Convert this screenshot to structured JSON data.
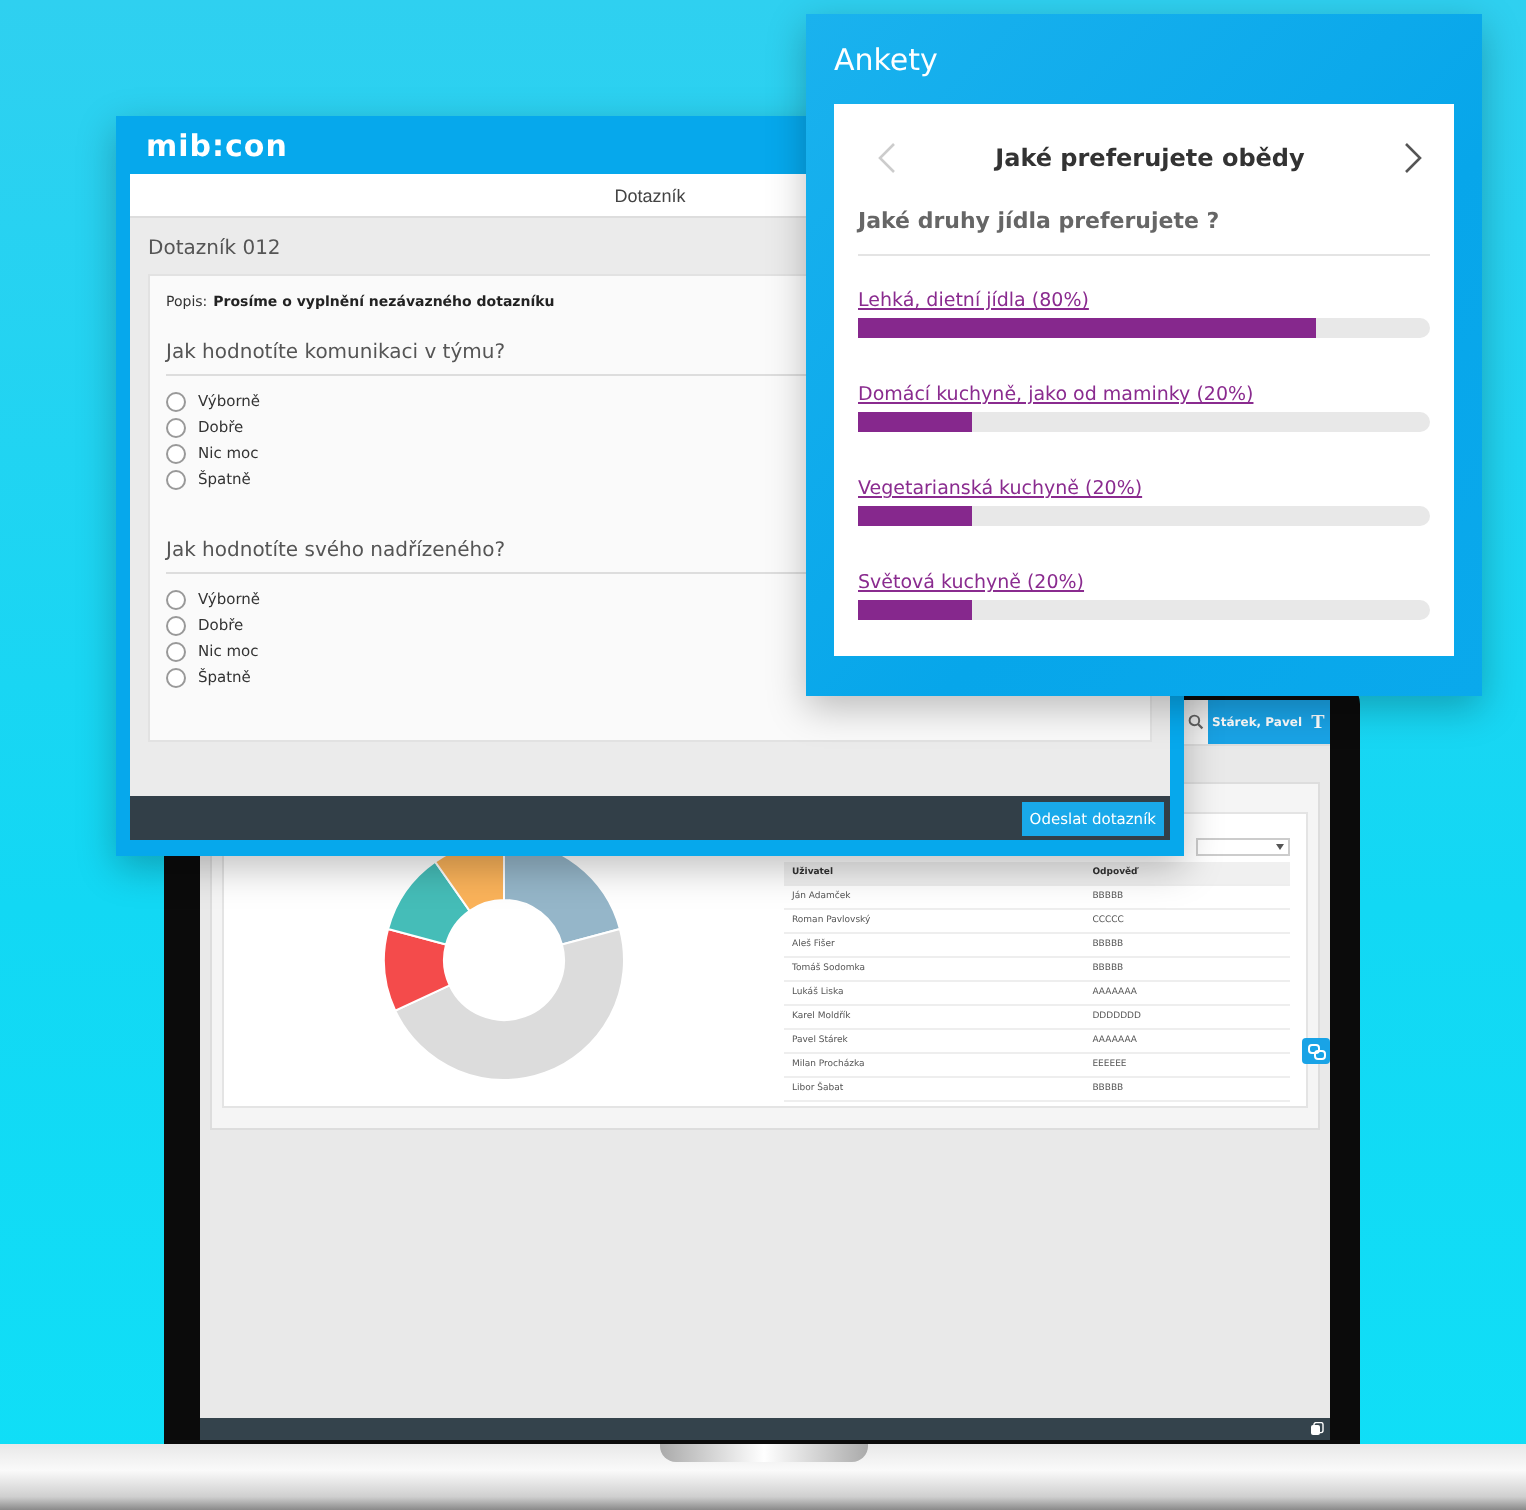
{
  "laptop_app": {
    "user": "Stárek, Pavel",
    "font_button": "T",
    "table": {
      "columns": [
        "Uživatel",
        "Odpověď"
      ],
      "rows": [
        [
          "Ján Adamček",
          "BBBBB"
        ],
        [
          "Roman Pavlovský",
          "CCCCC"
        ],
        [
          "Aleš Fišer",
          "BBBBB"
        ],
        [
          "Tomáš Sodomka",
          "BBBBB"
        ],
        [
          "Lukáš Liska",
          "AAAAAAA"
        ],
        [
          "Karel Moldřík",
          "DDDDDDD"
        ],
        [
          "Pavel Stárek",
          "AAAAAAA"
        ],
        [
          "Milan Procházka",
          "EEEEEE"
        ],
        [
          "Libor Šabat",
          "BBBBB"
        ]
      ]
    }
  },
  "survey_window": {
    "logo": "mib:con",
    "title": "Dotazník",
    "name": "Dotazník 012",
    "description_label": "Popis:",
    "description": "Prosíme o vyplnění nezávazného dotazníku",
    "questions": [
      {
        "text": "Jak hodnotíte komunikaci v týmu?",
        "options": [
          {
            "label": "Výborně",
            "selected": false
          },
          {
            "label": "Dobře",
            "selected": false
          },
          {
            "label": "Nic moc",
            "selected": false
          },
          {
            "label": "Špatně",
            "selected": false
          }
        ]
      },
      {
        "text": "Jak hodnotíte svého nadřízeného?",
        "options": [
          {
            "label": "Výborně",
            "selected": false
          },
          {
            "label": "Dobře",
            "selected": false
          },
          {
            "label": "Nic moc",
            "selected": false
          },
          {
            "label": "Špatně",
            "selected": false
          }
        ]
      }
    ],
    "submit": "Odeslat dotazník"
  },
  "polls_window": {
    "title": "Ankety",
    "poll_title": "Jaké preferujete obědy",
    "prev_disabled": true,
    "question": "Jaké druhy jídla preferujete ?",
    "answers": [
      {
        "label": "Lehká, dietní jídla (80%)",
        "level": 0.8
      },
      {
        "label": "Domácí kuchyně, jako od maminky (20%)",
        "level": 0.2
      },
      {
        "label": "Vegetarianská kuchyně (20%)",
        "level": 0.2
      },
      {
        "label": "Světová kuchyně (20%)",
        "level": 0.2
      }
    ]
  }
}
